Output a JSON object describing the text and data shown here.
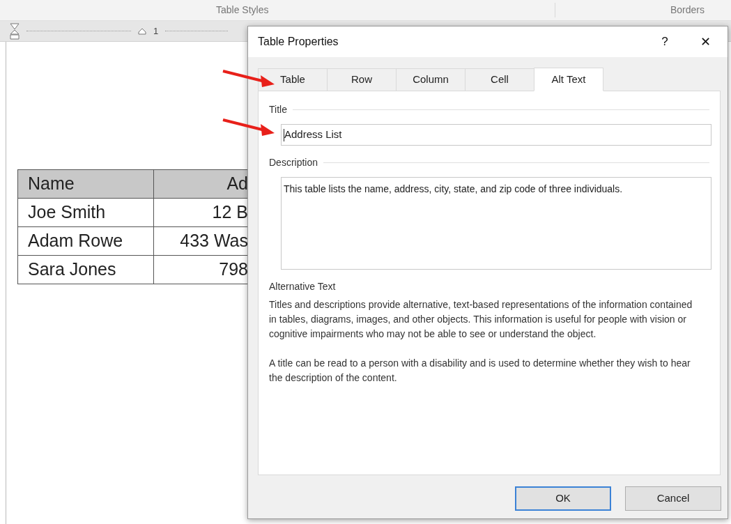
{
  "ribbon": {
    "groups": [
      "Table Styles",
      "Borders"
    ]
  },
  "ruler": {
    "number": "1"
  },
  "document_table": {
    "header": [
      "Name",
      "Ad"
    ],
    "rows": [
      [
        "Joe Smith",
        "12 B"
      ],
      [
        "Adam Rowe",
        "433 Was"
      ],
      [
        "Sara Jones",
        "798"
      ]
    ]
  },
  "dialog": {
    "title": "Table Properties",
    "help": "?",
    "close": "✕",
    "tabs": [
      {
        "label": "Table",
        "selected": false
      },
      {
        "label": "Row",
        "selected": false
      },
      {
        "label": "Column",
        "selected": false
      },
      {
        "label": "Cell",
        "selected": false
      },
      {
        "label": "Alt Text",
        "selected": true
      }
    ],
    "title_section": {
      "label": "Title",
      "value": "Address List"
    },
    "description_section": {
      "label": "Description",
      "value": "This table lists the name, address, city, state, and zip code of three individuals."
    },
    "help_heading": "Alternative Text",
    "help_paragraphs": [
      "Titles and descriptions provide alternative, text-based representations of the information contained in tables, diagrams, images, and other objects. This information is useful for people with vision or cognitive impairments who may not be able to see or understand the object.",
      "A title can be read to a person with a disability and is used to determine whether they wish to hear the description of the content."
    ],
    "buttons": [
      {
        "label": "OK",
        "default": true
      },
      {
        "label": "Cancel",
        "default": false
      }
    ]
  }
}
